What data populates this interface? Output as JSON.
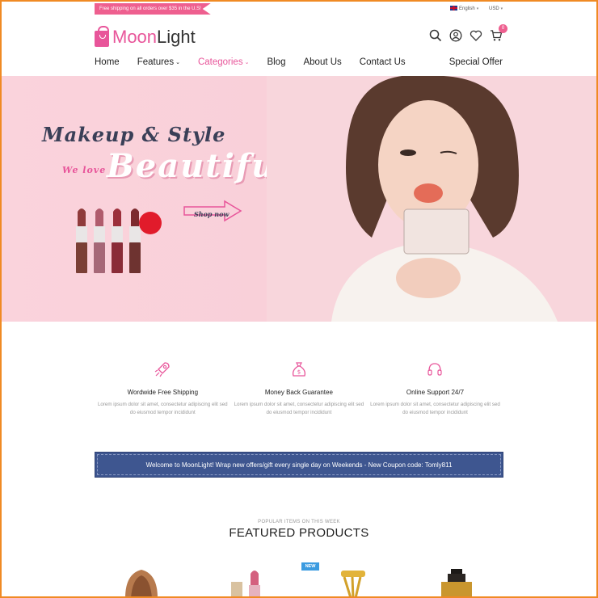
{
  "topbar": {
    "promo": "Free shipping on all orders over $35 in the U.S!",
    "language": "English",
    "currency": "USD"
  },
  "logo": {
    "part1": "Moon",
    "part2": "Light"
  },
  "header_icons": [
    "search-icon",
    "user-icon",
    "heart-icon",
    "cart-icon"
  ],
  "cart_count": "0",
  "nav": {
    "items": [
      {
        "label": "Home",
        "dropdown": false
      },
      {
        "label": "Features",
        "dropdown": true
      },
      {
        "label": "Categories",
        "dropdown": true,
        "active": true
      },
      {
        "label": "Blog",
        "dropdown": false
      },
      {
        "label": "About Us",
        "dropdown": false
      },
      {
        "label": "Contact Us",
        "dropdown": false
      }
    ],
    "special": "Special Offer"
  },
  "hero": {
    "title": "Makeup & Style",
    "we_love": "We love",
    "beautiful": "Beautiful",
    "cta": "Shop now"
  },
  "features": [
    {
      "icon": "rocket-icon",
      "title": "Wordwide Free Shipping",
      "desc": "Lorem ipsum dolor sit amet, consectetur adipiscing elit sed do eiusmod tempor incididunt"
    },
    {
      "icon": "money-bag-icon",
      "title": "Money Back Guarantee",
      "desc": "Lorem ipsum dolor sit amet, consectetur adipiscing elit sed do eiusmod tempor incididunt"
    },
    {
      "icon": "headphones-icon",
      "title": "Online Support 24/7",
      "desc": "Lorem ipsum dolor sit amet, consectetur adipiscing elit sed do eiusmod tempor incididunt"
    }
  ],
  "welcome": "Welcome to MoonLight! Wrap new offers/gift every single day on Weekends - New Coupon code: Tomly811",
  "products_section": {
    "kicker": "POPULAR ITEMS ON THIS WEEK",
    "title": "FEATURED PRODUCTS",
    "badge": "NEW"
  },
  "colors": {
    "accent": "#e8559a",
    "banner": "#3e5690",
    "frame": "#f08a24",
    "badge": "#3b9be0"
  }
}
